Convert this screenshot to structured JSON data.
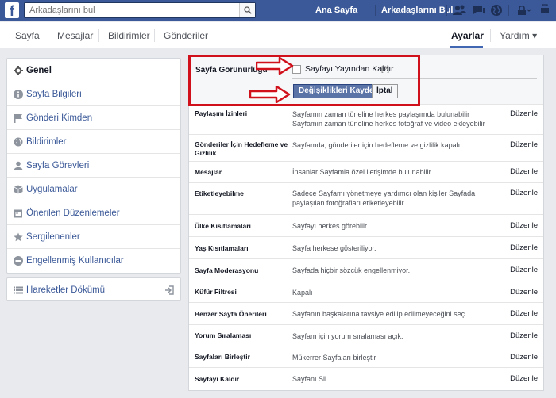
{
  "topbar": {
    "logo": "f",
    "search": {
      "placeholder": "Arkadaşlarını bul"
    },
    "links": [
      "Ana Sayfa",
      "Arkadaşlarını Bul"
    ],
    "icons": [
      "friend-requests-icon",
      "messages-icon",
      "notifications-globe-icon",
      "privacy-shortcuts-icon",
      "account-menu-icon"
    ]
  },
  "subnav": {
    "tabs": [
      "Sayfa",
      "Mesajlar",
      "Bildirimler",
      "Gönderiler"
    ],
    "active_tab": "Ayarlar",
    "help": "Yardım ▾"
  },
  "sidebar": {
    "items": [
      {
        "label": "Genel",
        "icon": "gear-icon",
        "selected": true
      },
      {
        "label": "Sayfa Bilgileri",
        "icon": "info-icon"
      },
      {
        "label": "Gönderi Kimden",
        "icon": "flag-icon"
      },
      {
        "label": "Bildirimler",
        "icon": "globe-icon"
      },
      {
        "label": "Sayfa Görevleri",
        "icon": "person-icon"
      },
      {
        "label": "Uygulamalar",
        "icon": "cube-icon"
      },
      {
        "label": "Önerilen Düzenlemeler",
        "icon": "calendar-icon"
      },
      {
        "label": "Sergilenenler",
        "icon": "star-icon"
      },
      {
        "label": "Engellenmiş Kullanıcılar",
        "icon": "blocked-icon"
      }
    ],
    "activity_log": "Hareketler Dökümü"
  },
  "visibility": {
    "label": "Sayfa Görünürlüğü",
    "checkbox_label": "Sayfayı Yayından Kaldır",
    "help": "[?]",
    "save": "Değişiklikleri Kaydet",
    "cancel": "İptal"
  },
  "settings": {
    "edit_label": "Düzenle",
    "rows": [
      {
        "label": "Paylaşım İzinleri",
        "desc": "Sayfamın zaman tüneline herkes paylaşımda bulunabilir\nSayfamın zaman tüneline herkes fotoğraf ve video ekleyebilir"
      },
      {
        "label": "Gönderiler İçin Hedefleme ve Gizlilik",
        "desc": "Sayfamda, gönderiler için hedefleme ve gizlilik kapalı"
      },
      {
        "label": "Mesajlar",
        "desc": "İnsanlar Sayfamla özel iletişimde bulunabilir."
      },
      {
        "label": "Etiketleyebilme",
        "desc": "Sadece Sayfamı yönetmeye yardımcı olan kişiler Sayfada paylaşılan fotoğrafları etiketleyebilir."
      },
      {
        "label": "Ülke Kısıtlamaları",
        "desc": "Sayfayı herkes görebilir."
      },
      {
        "label": "Yaş Kısıtlamaları",
        "desc": "Sayfa herkese gösteriliyor."
      },
      {
        "label": "Sayfa Moderasyonu",
        "desc": "Sayfada hiçbir sözcük engellenmiyor."
      },
      {
        "label": "Küfür Filtresi",
        "desc": "Kapalı"
      },
      {
        "label": "Benzer Sayfa Önerileri",
        "desc": "Sayfanın başkalarına tavsiye edilip edilmeyeceğini seç"
      },
      {
        "label": "Yorum Sıralaması",
        "desc": "Sayfam için yorum sıralaması açık."
      },
      {
        "label": "Sayfaları Birleştir",
        "desc": "Mükerrer Sayfaları birleştir"
      },
      {
        "label": "Sayfayı Kaldır",
        "desc": "Sayfanı Sil"
      }
    ]
  },
  "colors": {
    "topbar": "#3b5998",
    "link": "#3b5998",
    "save_button": "#5b74a8",
    "annotation_red": "#d0101b"
  }
}
